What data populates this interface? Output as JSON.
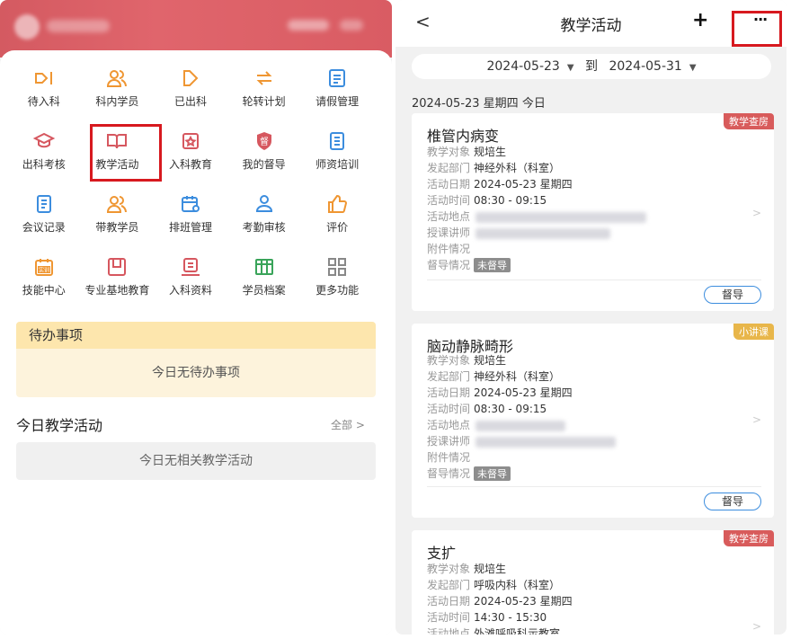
{
  "left": {
    "grid": [
      {
        "label": "待入科",
        "icon": "enter-icon",
        "color": "#ef9632"
      },
      {
        "label": "科内学员",
        "icon": "users-icon",
        "color": "#ef9632"
      },
      {
        "label": "已出科",
        "icon": "exit-icon",
        "color": "#ef9632"
      },
      {
        "label": "轮转计划",
        "icon": "rotate-icon",
        "color": "#ef9632"
      },
      {
        "label": "请假管理",
        "icon": "leave-icon",
        "color": "#3c8dde"
      },
      {
        "label": "出科考核",
        "icon": "graduation-icon",
        "color": "#d6575f"
      },
      {
        "label": "教学活动",
        "icon": "book-icon",
        "color": "#d6575f"
      },
      {
        "label": "入科教育",
        "icon": "education-icon",
        "color": "#d6575f"
      },
      {
        "label": "我的督导",
        "icon": "supervise-icon",
        "color": "#d6575f"
      },
      {
        "label": "师资培训",
        "icon": "document-icon",
        "color": "#3c8dde"
      },
      {
        "label": "会议记录",
        "icon": "notes-icon",
        "color": "#3c8dde"
      },
      {
        "label": "带教学员",
        "icon": "mentor-icon",
        "color": "#ef9632"
      },
      {
        "label": "排班管理",
        "icon": "calendar-icon",
        "color": "#3c8dde"
      },
      {
        "label": "考勤审核",
        "icon": "attendance-icon",
        "color": "#3c8dde"
      },
      {
        "label": "评价",
        "icon": "thumbs-up-icon",
        "color": "#ef9632"
      },
      {
        "label": "技能中心",
        "icon": "skill-icon",
        "color": "#ef9632"
      },
      {
        "label": "专业基地教育",
        "icon": "base-icon",
        "color": "#d6575f"
      },
      {
        "label": "入科资料",
        "icon": "materials-icon",
        "color": "#d6575f"
      },
      {
        "label": "学员档案",
        "icon": "archive-icon",
        "color": "#3aa45a"
      },
      {
        "label": "更多功能",
        "icon": "more-grid-icon",
        "color": "#888888"
      }
    ],
    "skill_icon_text": "实训",
    "supervise_icon_text": "督",
    "todo": {
      "title": "待办事项",
      "empty": "今日无待办事项"
    },
    "today": {
      "title": "今日教学活动",
      "all": "全部 >",
      "empty": "今日无相关教学活动"
    }
  },
  "right": {
    "back": "<",
    "title": "教学活动",
    "plus": "+",
    "more": "···",
    "date_start": "2024-05-23",
    "date_sep": "到",
    "date_end": "2024-05-31",
    "day_label": "2024-05-23 星期四 今日",
    "supervise_btn": "督导",
    "labels": {
      "target": "教学对象",
      "dept": "发起部门",
      "date": "活动日期",
      "time": "活动时间",
      "place": "活动地点",
      "lecturer": "授课讲师",
      "attach": "附件情况",
      "supervision": "督导情况"
    },
    "cards": [
      {
        "tag": "教学查房",
        "tag_color": "#d85b5b",
        "title": "椎管内病变",
        "target": "规培生",
        "dept": "神经外科（科室）",
        "date": "2024-05-23 星期四",
        "time": "08:30 - 09:15",
        "status": "未督导"
      },
      {
        "tag": "小讲课",
        "tag_color": "#e8b64a",
        "title": "脑动静脉畸形",
        "target": "规培生",
        "dept": "神经外科（科室）",
        "date": "2024-05-23 星期四",
        "time": "08:30 - 09:15",
        "status": "未督导"
      },
      {
        "tag": "教学查房",
        "tag_color": "#d85b5b",
        "title": "支扩",
        "target": "规培生",
        "dept": "呼吸内科（科室）",
        "date": "2024-05-23 星期四",
        "time": "14:30 - 15:30",
        "place": "外滩呼吸科示教室"
      }
    ]
  }
}
